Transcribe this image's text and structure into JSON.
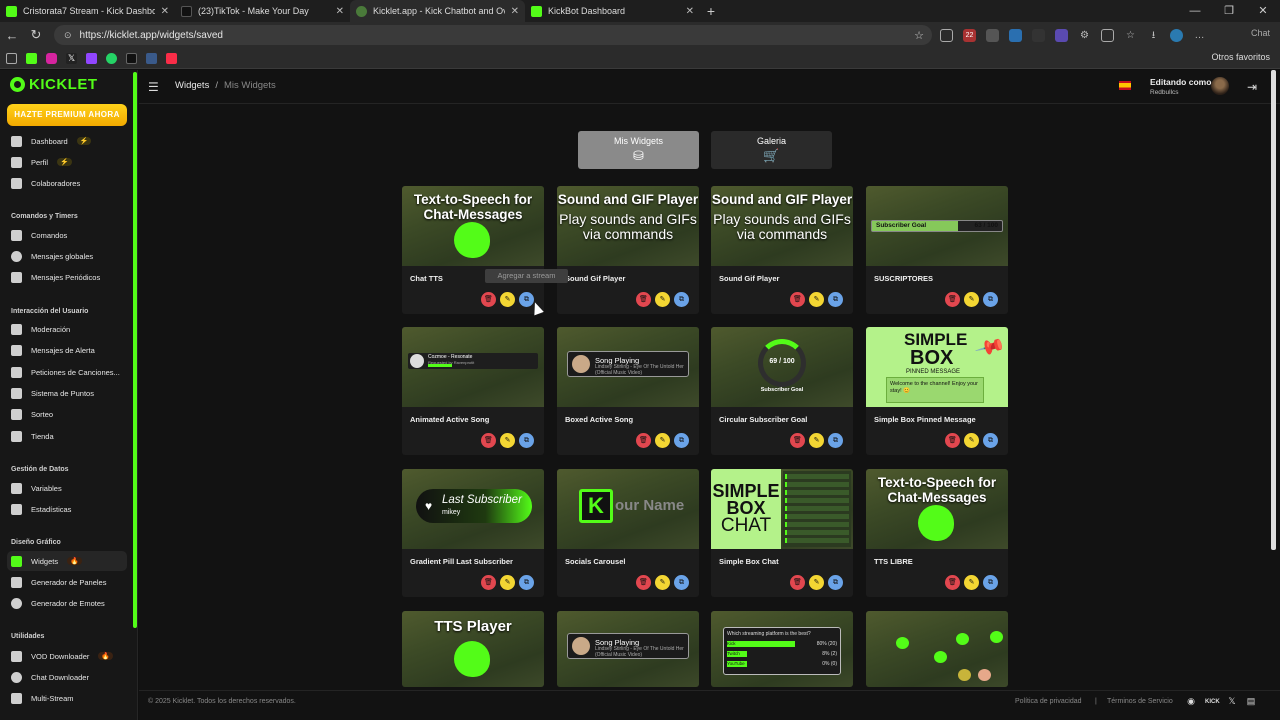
{
  "browser": {
    "tabs": [
      {
        "title": "Cristorata7 Stream - Kick Dashboard",
        "color": "#53fc18"
      },
      {
        "title": "(23)TikTok - Make Your Day",
        "color": "#111111"
      },
      {
        "title": "Kicklet.app - Kick Chatbot and Ov",
        "color": "#4a7a3a"
      },
      {
        "title": "KickBot Dashboard",
        "color": "#53fc18"
      }
    ],
    "url": "https://kicklet.app/widgets/saved",
    "other_bookmarks": "Otros favoritos",
    "chat_label": "Chat",
    "ext_badge": "22"
  },
  "sidebar": {
    "brand": "KICKLET",
    "premium": "HAZTE PREMIUM AHORA",
    "top_items": [
      {
        "label": "Dashboard",
        "icon": "dashboard-icon"
      },
      {
        "label": "Perfil",
        "icon": "profile-icon"
      },
      {
        "label": "Colaboradores",
        "icon": "collaborators-icon"
      }
    ],
    "sections": [
      {
        "title": "Comandos y Timers",
        "items": [
          "Comandos",
          "Mensajes globales",
          "Mensajes Periódicos"
        ]
      },
      {
        "title": "Interacción del Usuario",
        "items": [
          "Moderación",
          "Mensajes de Alerta",
          "Peticiones de Canciones...",
          "Sistema de Puntos",
          "Sorteo",
          "Tienda"
        ]
      },
      {
        "title": "Gestión de Datos",
        "items": [
          "Variables",
          "Estadísticas"
        ]
      },
      {
        "title": "Diseño Gráfico",
        "items": [
          "Widgets",
          "Generador de Paneles",
          "Generador de Emotes"
        ]
      },
      {
        "title": "Utilidades",
        "items": [
          "VOD Downloader",
          "Chat Downloader",
          "Multi-Stream"
        ]
      }
    ]
  },
  "header": {
    "breadcrumb_root": "Widgets",
    "breadcrumb_sep": "/",
    "breadcrumb_current": "Mis Widgets",
    "editing_label": "Editando como",
    "username": "Redbullcs"
  },
  "view_tabs": {
    "mine": "Mis Widgets",
    "gallery": "Galeria"
  },
  "tooltip": "Agregar a stream",
  "widgets": [
    {
      "name": "Chat TTS",
      "thumb_title": "Text-to-Speech for Chat-Messages"
    },
    {
      "name": "Sound Gif Player",
      "thumb_title": "Sound and GIF Player",
      "thumb_sub": "Play sounds and GIFs via commands"
    },
    {
      "name": "Sound Gif Player",
      "thumb_title": "Sound and GIF Player",
      "thumb_sub": "Play sounds and GIFs via commands"
    },
    {
      "name": "SUSCRIPTORES",
      "bar_label": "Subscriber Goal",
      "bar_value": "63 / 100"
    },
    {
      "name": "Animated Active Song",
      "song_artist": "Cozmoe - Resonate",
      "song_by": "Requested by Ravenprotit"
    },
    {
      "name": "Boxed Active Song",
      "song_title": "Song Playing",
      "song_sub": "Lindsey Stirling - Eye Of The Untold Her (Official Music Video)"
    },
    {
      "name": "Circular Subscriber Goal",
      "ring_value": "69 / 100",
      "ring_label": "Subscriber Goal"
    },
    {
      "name": "Simple Box Pinned Message",
      "w1": "SIMPLE",
      "w2": "BOX",
      "w3": "PINNED MESSAGE",
      "pin_msg": "Welcome to the channel! Enjoy your stay! 😊"
    },
    {
      "name": "Gradient Pill Last Subscriber",
      "pill_title": "Last Subscriber",
      "pill_user": "mikey"
    },
    {
      "name": "Socials Carousel",
      "carousel_text": "our Name"
    },
    {
      "name": "Simple Box Chat",
      "w1": "SIMPLE",
      "w2": "BOX",
      "w3": "CHAT"
    },
    {
      "name": "TTS LIBRE",
      "thumb_title": "Text-to-Speech for Chat-Messages"
    },
    {
      "name": "",
      "thumb_title": "TTS Player"
    },
    {
      "name": "",
      "song_title": "Song Playing",
      "song_sub": "Lindsey Stirling - Eye Of The Untold Her (Official Music Video)"
    },
    {
      "name": "",
      "poll_question": "Which streaming platform is the best?",
      "poll_rows": [
        {
          "label": "Kick",
          "pct": "80% (20)",
          "value": 0.8
        },
        {
          "label": "Twitch",
          "pct": "8% (2)",
          "value": 0.08
        },
        {
          "label": "YouTube",
          "pct": "0% (0)",
          "value": 0.0
        }
      ]
    },
    {
      "name": ""
    }
  ],
  "footer": {
    "copyright": "© 2025 Kicklet. Todos los derechos reservados.",
    "privacy": "Política de privacidad",
    "sep": "|",
    "terms": "Términos de Servicio"
  }
}
